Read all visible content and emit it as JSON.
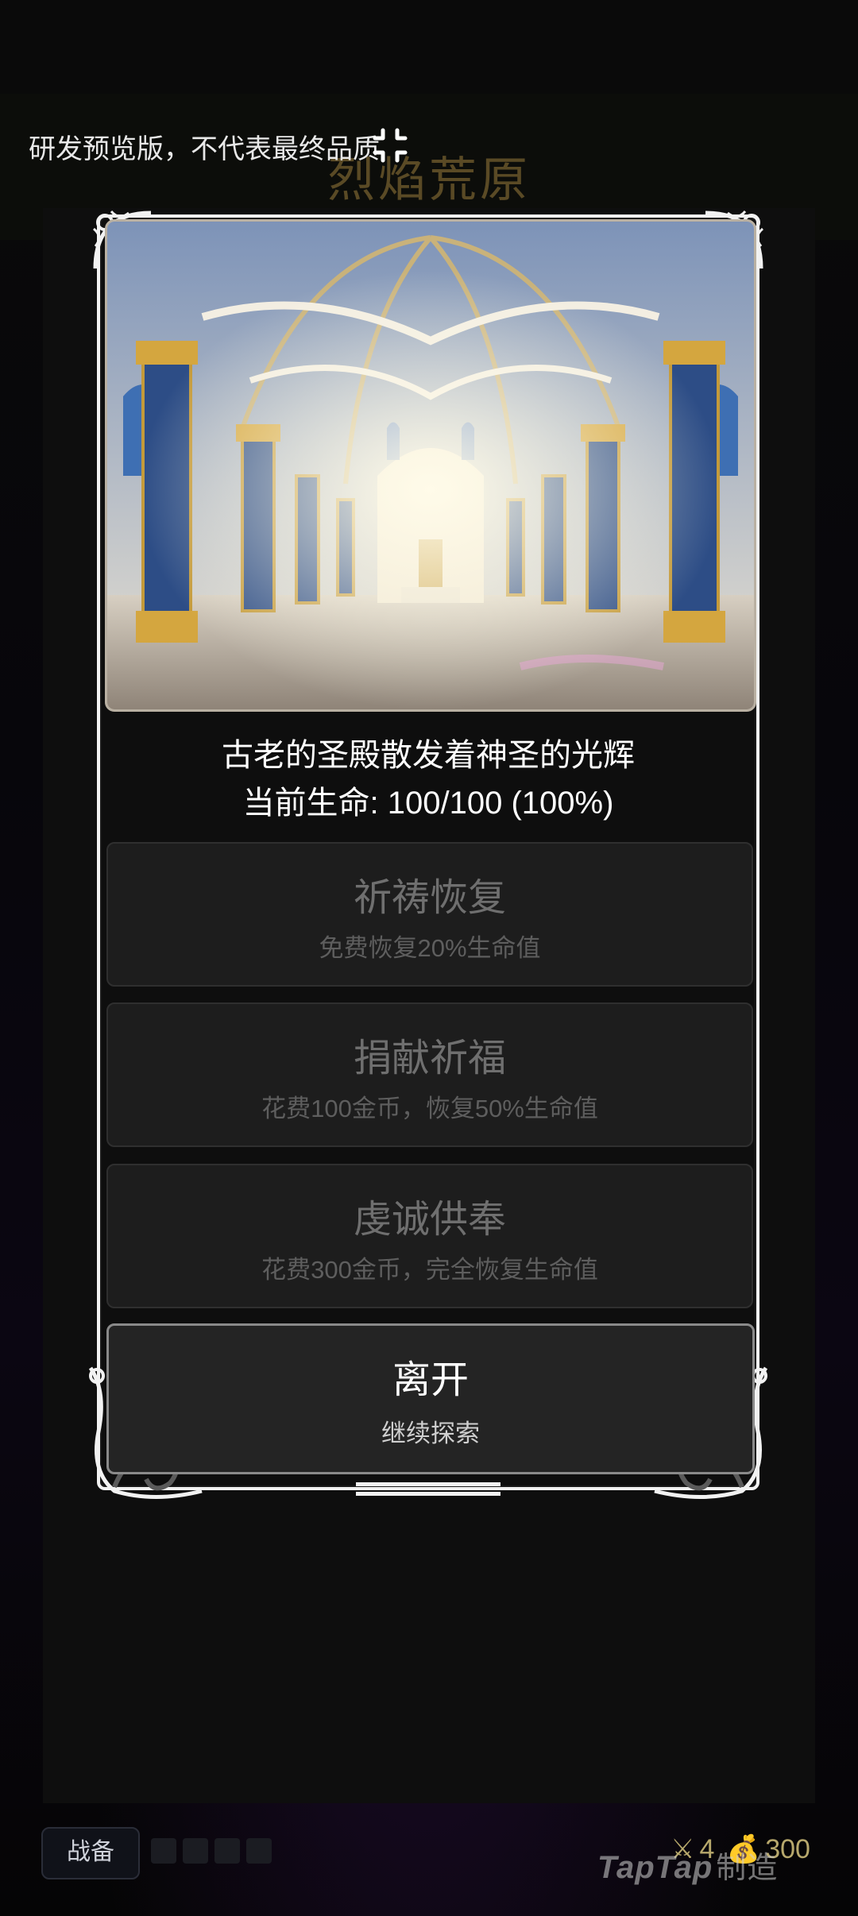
{
  "background": {
    "game_title": "烈焰荒原",
    "preview_notice": "研发预览版，不代表最终品质"
  },
  "bottom": {
    "gear_button_label": "战备",
    "sword_count": "4",
    "gold_amount": "300",
    "watermark_brand": "TapTap",
    "watermark_suffix": "制造"
  },
  "event": {
    "image_icon": "cathedral-image",
    "description": "古老的圣殿散发着神圣的光辉",
    "hp_status": "当前生命: 100/100 (100%)",
    "options": [
      {
        "title": "祈祷恢复",
        "subtitle": "免费恢复20%生命值"
      },
      {
        "title": "捐献祈福",
        "subtitle": "花费100金币，恢复50%生命值"
      },
      {
        "title": "虔诚供奉",
        "subtitle": "花费300金币，完全恢复生命值"
      },
      {
        "title": "离开",
        "subtitle": "继续探索"
      }
    ]
  },
  "colors": {
    "frame": "#f2f2f2",
    "gold_text": "#b7a86c",
    "disabled_text": "#6f6f6f"
  }
}
